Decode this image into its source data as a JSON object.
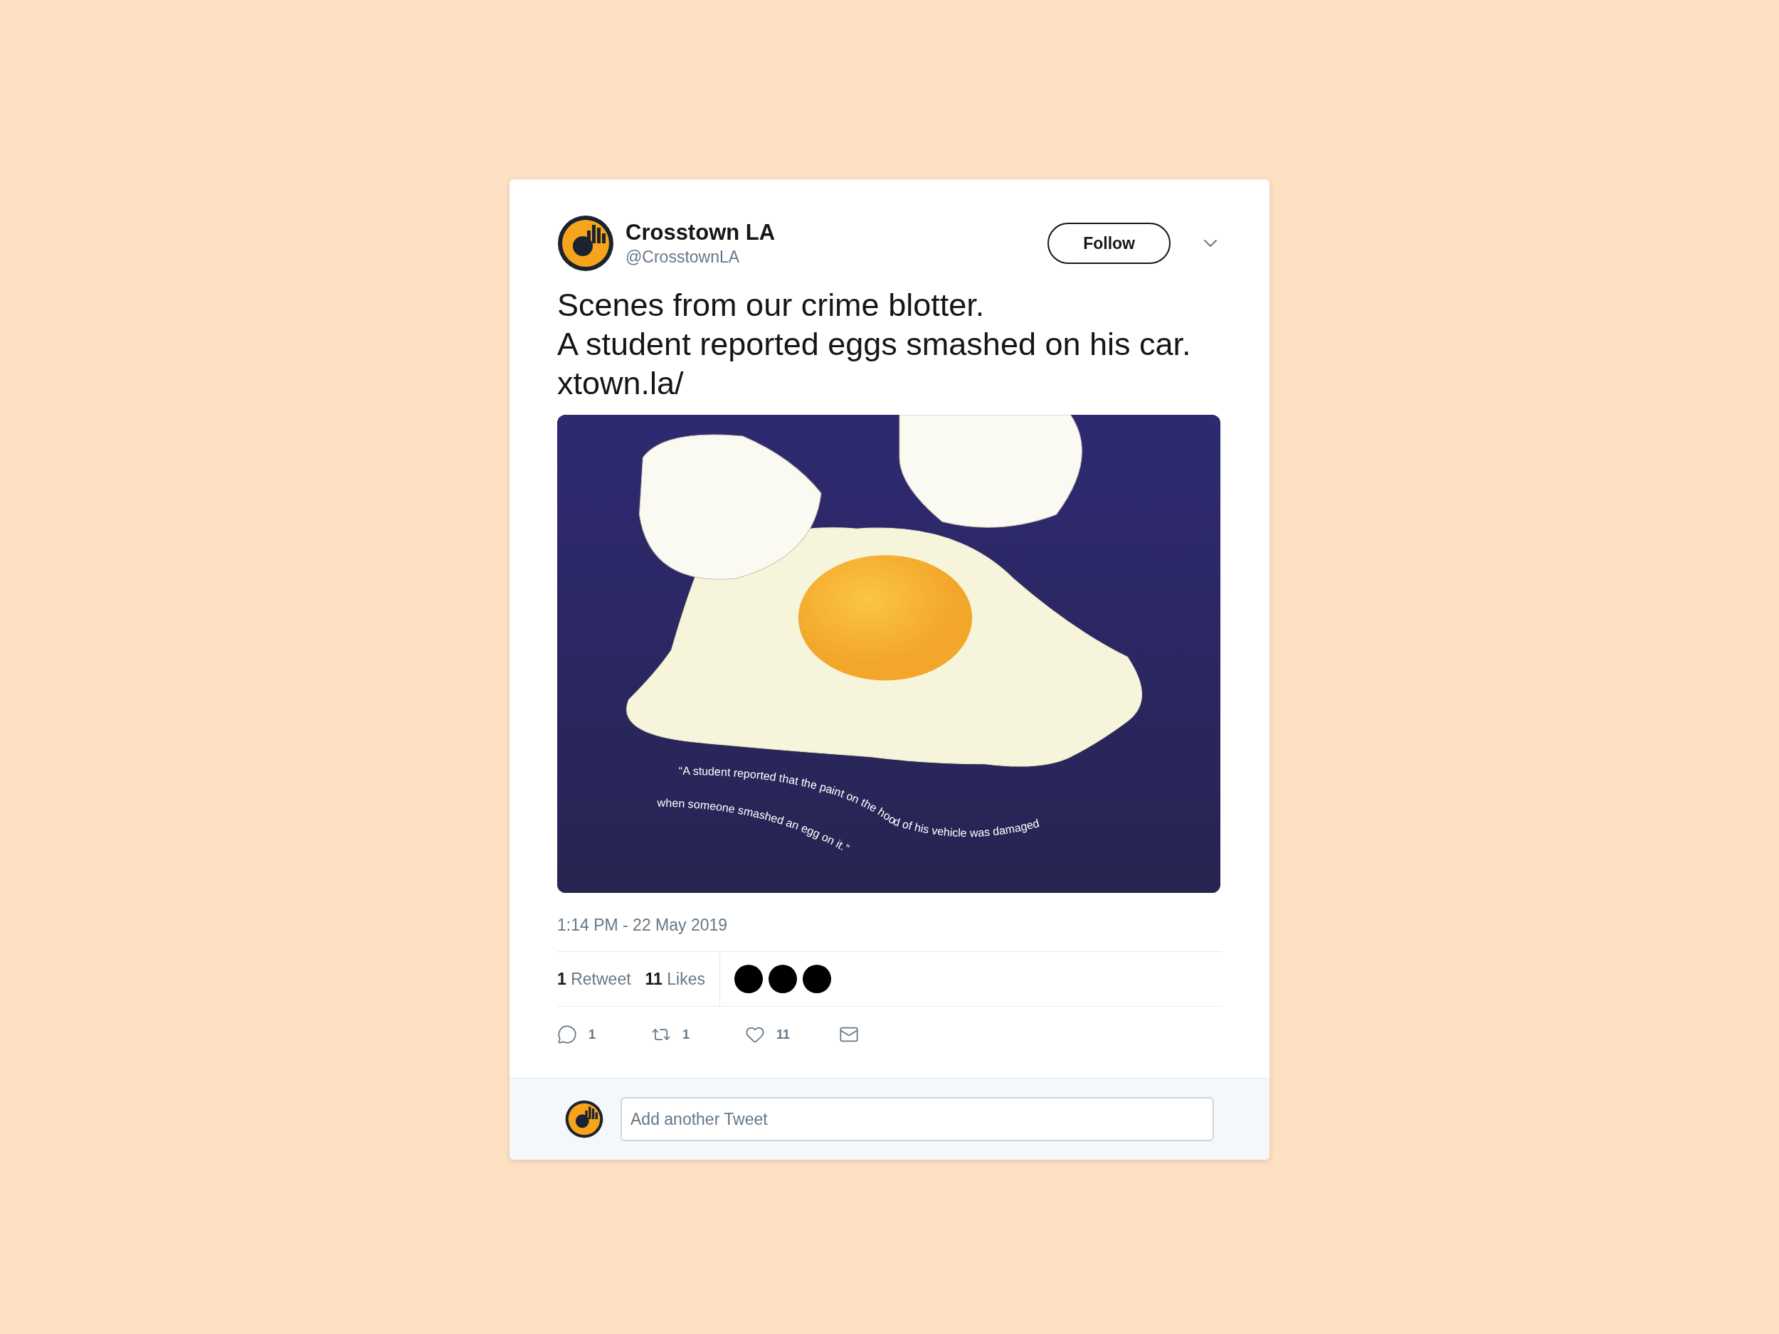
{
  "account": {
    "name": "Crosstown LA",
    "handle": "@CrosstownLA"
  },
  "follow_button": "Follow",
  "tweet_lines": [
    "Scenes from our crime blotter.",
    "A student reported eggs smashed on his car.",
    "xtown.la/"
  ],
  "illustration": {
    "quote_lines": [
      "“A student reported that the paint on the hood of his vehicle was damaged",
      "when someone smashed an egg on it.”"
    ]
  },
  "timestamp": "1:14 PM - 22 May 2019",
  "stats": [
    {
      "count": "1",
      "label": "Retweet"
    },
    {
      "count": "11",
      "label": "Likes"
    }
  ],
  "actions": [
    {
      "kind": "reply",
      "count": "1"
    },
    {
      "kind": "retweet",
      "count": "1"
    },
    {
      "kind": "like",
      "count": "11"
    },
    {
      "kind": "message"
    }
  ],
  "reply_field": {
    "placeholder": "Add another Tweet"
  }
}
